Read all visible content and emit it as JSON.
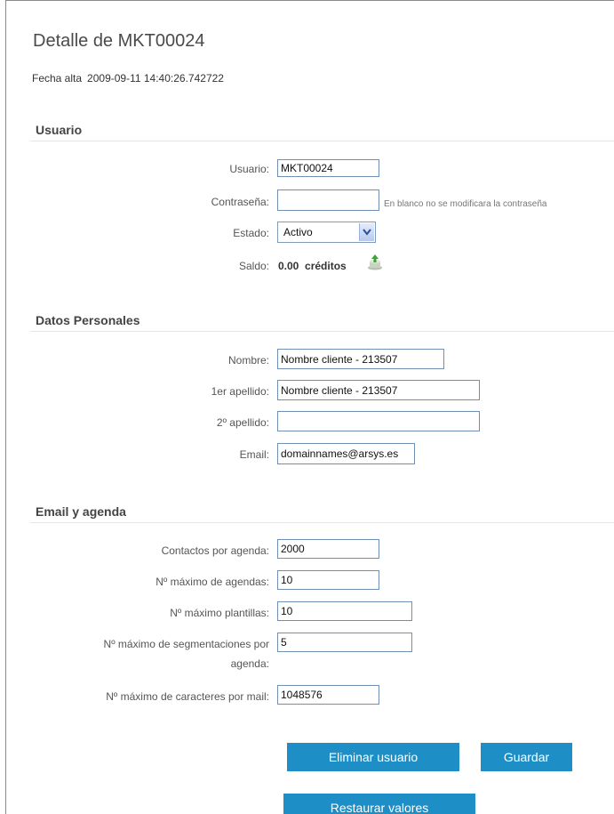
{
  "page": {
    "title": "Detalle de MKT00024",
    "fecha_label": "Fecha alta",
    "fecha_value": "2009-09-11 14:40:26.742722"
  },
  "usuario_section": {
    "title": "Usuario",
    "usuario_label": "Usuario:",
    "usuario_value": "MKT00024",
    "password_label": "Contraseña:",
    "password_value": "",
    "password_hint": "En blanco no se modificara la contraseña",
    "estado_label": "Estado:",
    "estado_value": "Activo",
    "saldo_label": "Saldo:",
    "saldo_value": "0.00  créditos",
    "saldo_icon": "add-credits-icon"
  },
  "personal_section": {
    "title": "Datos Personales",
    "nombre_label": "Nombre:",
    "nombre_value": "Nombre cliente - 213507",
    "apellido1_label": "1er apellido:",
    "apellido1_value": "Nombre cliente - 213507",
    "apellido2_label": "2º apellido:",
    "apellido2_value": "",
    "email_label": "Email:",
    "email_value": "domainnames@arsys.es"
  },
  "agenda_section": {
    "title": "Email y agenda",
    "contactos_label": "Contactos por agenda:",
    "contactos_value": "2000",
    "max_agendas_label": "Nº máximo de agendas:",
    "max_agendas_value": "10",
    "max_plantillas_label": "Nº máximo plantillas:",
    "max_plantillas_value": "10",
    "max_segmentaciones_label_1": "Nº máximo de segmentaciones por",
    "max_segmentaciones_label_2": "agenda:",
    "max_segmentaciones_value": "5",
    "max_caracteres_label": "Nº máximo de caracteres por mail:",
    "max_caracteres_value": "1048576"
  },
  "actions": {
    "eliminar_label": "Eliminar usuario",
    "guardar_label": "Guardar",
    "restaurar_label": "Restaurar valores"
  },
  "colors": {
    "button_bg": "#1e8fc6",
    "input_border": "#6f8fb5"
  }
}
